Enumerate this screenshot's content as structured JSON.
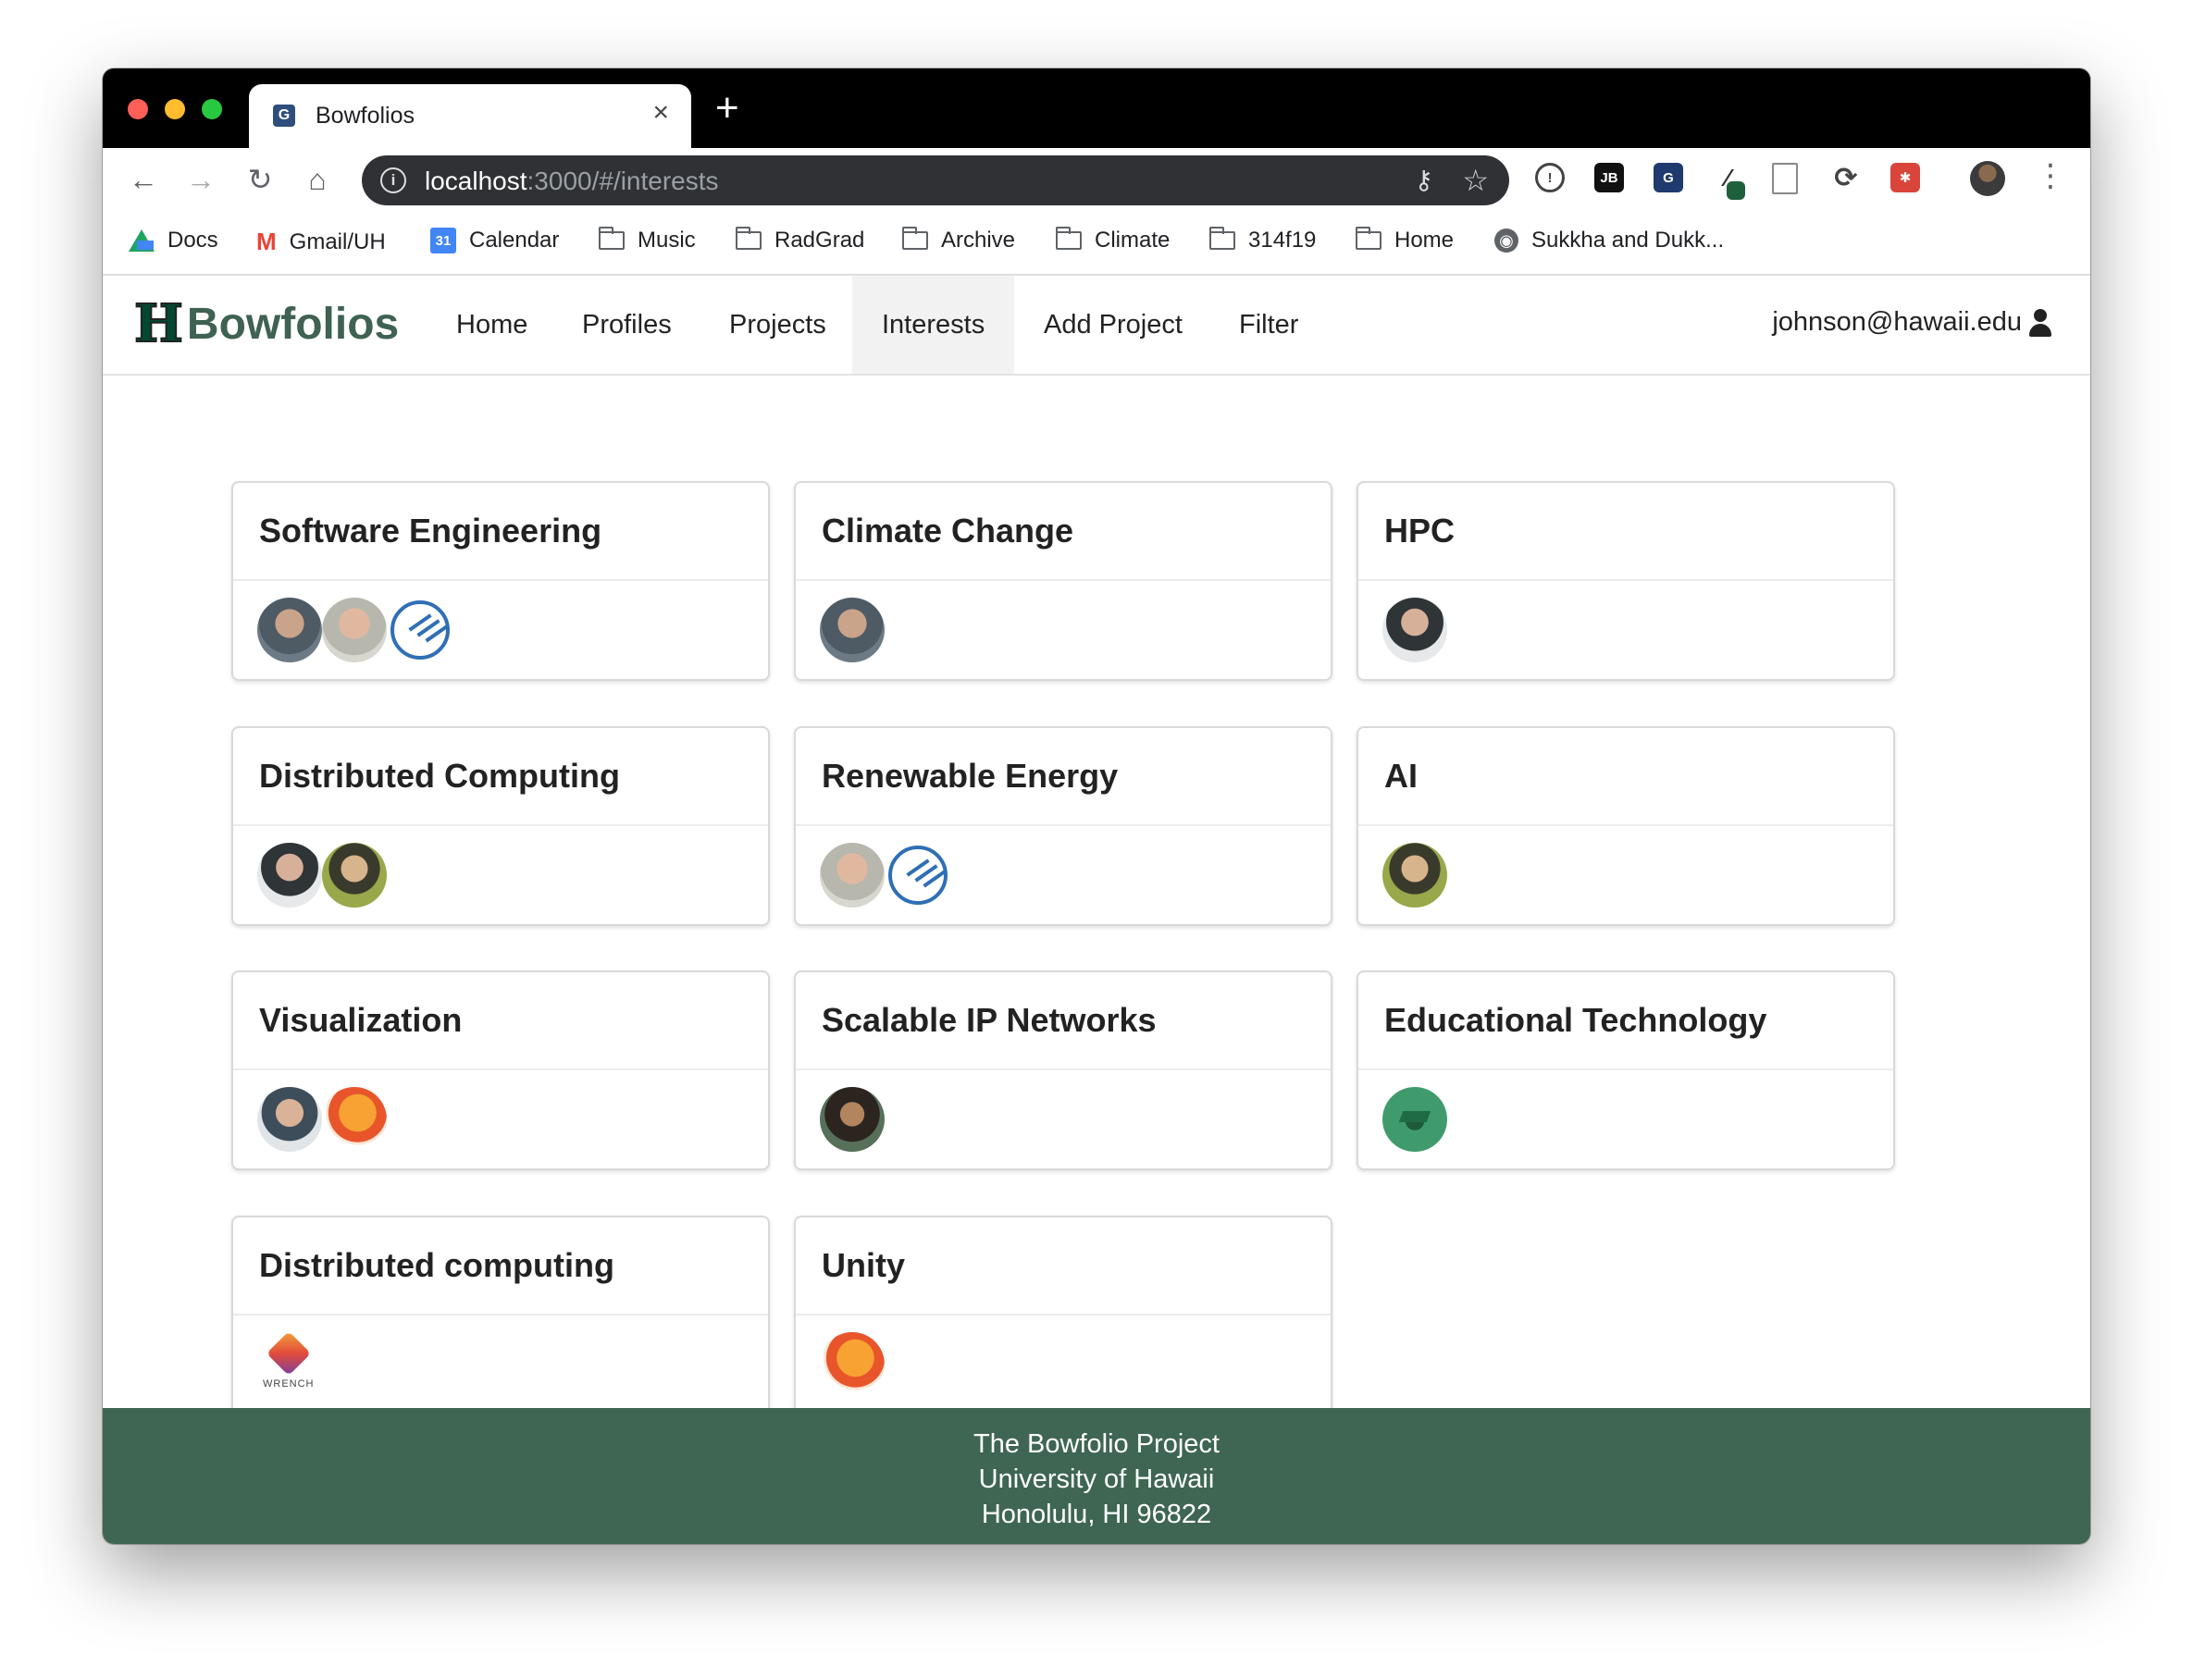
{
  "browser": {
    "tab_title": "Bowfolios",
    "tab_close": "×",
    "new_tab": "+",
    "url_host": "localhost",
    "url_path": ":3000/#/interests",
    "bookmarks": [
      "Docs",
      "Gmail/UH",
      "Calendar",
      "Music",
      "RadGrad",
      "Archive",
      "Climate",
      "314f19",
      "Home",
      "Sukkha and Dukk..."
    ],
    "calendar_day": "31",
    "gmail_letter": "M",
    "ext_jb": "JB"
  },
  "app": {
    "brand": "Bowfolios",
    "logo_letter": "H",
    "nav": [
      "Home",
      "Profiles",
      "Projects",
      "Interests",
      "Add Project",
      "Filter"
    ],
    "active_nav": "Interests",
    "user": "johnson@hawaii.edu"
  },
  "interests": [
    {
      "title": "Software Engineering"
    },
    {
      "title": "Climate Change"
    },
    {
      "title": "HPC"
    },
    {
      "title": "Distributed Computing"
    },
    {
      "title": "Renewable Energy"
    },
    {
      "title": "AI"
    },
    {
      "title": "Visualization"
    },
    {
      "title": "Scalable IP Networks"
    },
    {
      "title": "Educational Technology"
    },
    {
      "title": "Distributed computing"
    },
    {
      "title": "Unity"
    }
  ],
  "wrench_label": "WRENCH",
  "footer": {
    "line1": "The Bowfolio Project",
    "line2": "University of Hawaii",
    "line3": "Honolulu, HI 96822"
  },
  "colors": {
    "brand_green": "#3f6252",
    "footer_bg": "#3e6652",
    "radgrad_blue": "#2f6fb5"
  }
}
